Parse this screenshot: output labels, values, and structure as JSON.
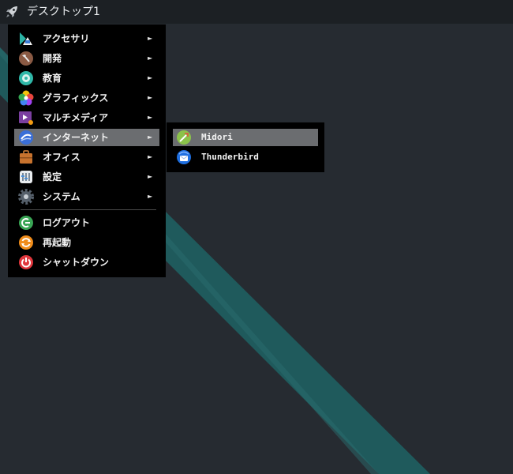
{
  "panel": {
    "workspace_label": "デスクトップ1",
    "launcher_icon": "rocket-icon"
  },
  "menu": {
    "items": [
      {
        "label": "アクセサリ",
        "icon": "accessories-icon",
        "has_submenu": true
      },
      {
        "label": "開発",
        "icon": "development-icon",
        "has_submenu": true
      },
      {
        "label": "教育",
        "icon": "education-icon",
        "has_submenu": true
      },
      {
        "label": "グラフィックス",
        "icon": "graphics-icon",
        "has_submenu": true
      },
      {
        "label": "マルチメディア",
        "icon": "multimedia-icon",
        "has_submenu": true
      },
      {
        "label": "インターネット",
        "icon": "internet-icon",
        "has_submenu": true,
        "highlighted": true
      },
      {
        "label": "オフィス",
        "icon": "office-icon",
        "has_submenu": true
      },
      {
        "label": "設定",
        "icon": "settings-icon",
        "has_submenu": true
      },
      {
        "label": "システム",
        "icon": "system-icon",
        "has_submenu": true
      }
    ],
    "actions": [
      {
        "label": "ログアウト",
        "icon": "logout-icon"
      },
      {
        "label": "再起動",
        "icon": "reboot-icon"
      },
      {
        "label": "シャットダウン",
        "icon": "shutdown-icon"
      }
    ],
    "arrow_glyph": "►"
  },
  "submenu": {
    "items": [
      {
        "label": "Midori",
        "icon": "midori-icon",
        "highlighted": true
      },
      {
        "label": "Thunderbird",
        "icon": "thunderbird-icon"
      }
    ]
  },
  "colors": {
    "desktop_bg": "#262b31",
    "stripe": "#1f5a5c",
    "panel_bg": "#1c2024",
    "menu_bg": "#000000",
    "highlight": "#6b6d70"
  }
}
